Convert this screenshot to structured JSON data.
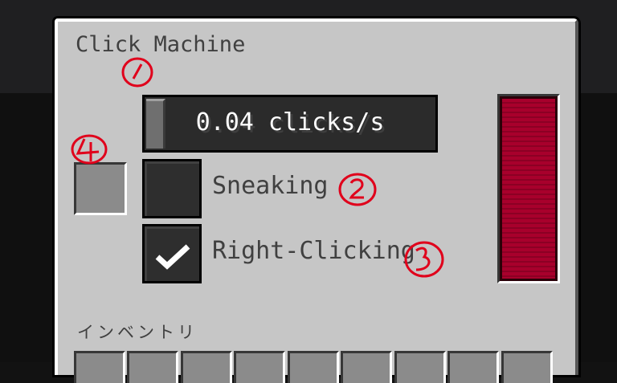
{
  "window": {
    "title": "Click Machine"
  },
  "slider": {
    "label": "0.04 clicks/s",
    "value": 0.02
  },
  "checkboxes": [
    {
      "label": "Sneaking",
      "checked": false
    },
    {
      "label": "Right-Clicking",
      "checked": true
    }
  ],
  "energy_bar": {
    "fill_fraction": 1.0,
    "color": "#a8002c"
  },
  "inventory": {
    "title": "インベントリ"
  },
  "annotations": [
    "1",
    "2",
    "3",
    "4"
  ],
  "colors": {
    "panel": "#c6c6c6",
    "text": "#404040",
    "annotation": "#e0001b"
  }
}
